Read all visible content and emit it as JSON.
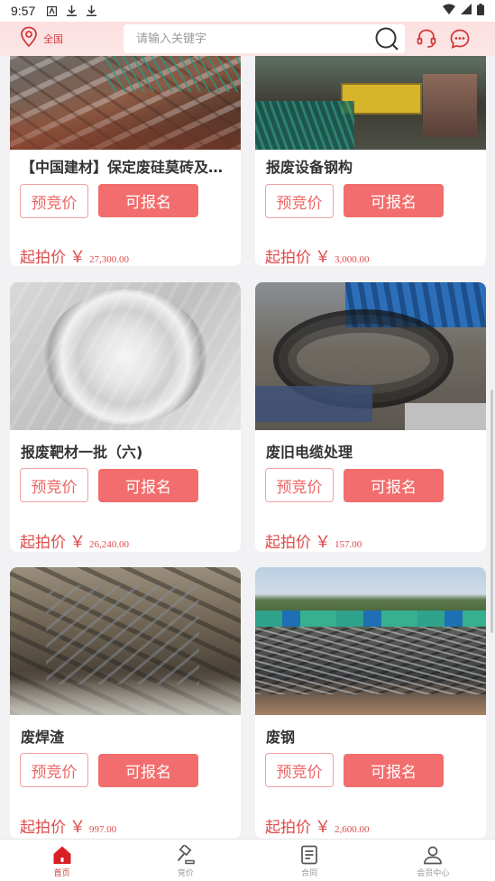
{
  "status_bar": {
    "time": "9:57"
  },
  "header": {
    "location_label": "全国",
    "search_placeholder": "请输入关键字"
  },
  "cards": [
    {
      "title": "【中国建材】保定废硅莫砖及…",
      "pre_bid_label": "预竞价",
      "register_label": "可报名",
      "price_label": "起拍价",
      "currency": "￥",
      "price": "27,300.00"
    },
    {
      "title": "报废设备钢构",
      "pre_bid_label": "预竞价",
      "register_label": "可报名",
      "price_label": "起拍价",
      "currency": "￥",
      "price": "3,000.00"
    },
    {
      "title": "报废靶材一批（六)",
      "pre_bid_label": "预竞价",
      "register_label": "可报名",
      "price_label": "起拍价",
      "currency": "￥",
      "price": "26,240.00"
    },
    {
      "title": "废旧电缆处理",
      "pre_bid_label": "预竞价",
      "register_label": "可报名",
      "price_label": "起拍价",
      "currency": "￥",
      "price": "157.00"
    },
    {
      "title": "废焊渣",
      "pre_bid_label": "预竞价",
      "register_label": "可报名",
      "price_label": "起拍价",
      "currency": "￥",
      "price": "997.00"
    },
    {
      "title": "废钢",
      "pre_bid_label": "预竞价",
      "register_label": "可报名",
      "price_label": "起拍价",
      "currency": "￥",
      "price": "2,600.00"
    }
  ],
  "tabs": [
    {
      "label": "首页",
      "icon": "home-icon",
      "active": true
    },
    {
      "label": "竞价",
      "icon": "gavel-icon",
      "active": false
    },
    {
      "label": "合同",
      "icon": "contract-icon",
      "active": false
    },
    {
      "label": "会员中心",
      "icon": "user-icon",
      "active": false
    }
  ],
  "colors": {
    "accent": "#f26d6d",
    "price": "#e04a4a",
    "header_bg": "#fde0e0"
  }
}
